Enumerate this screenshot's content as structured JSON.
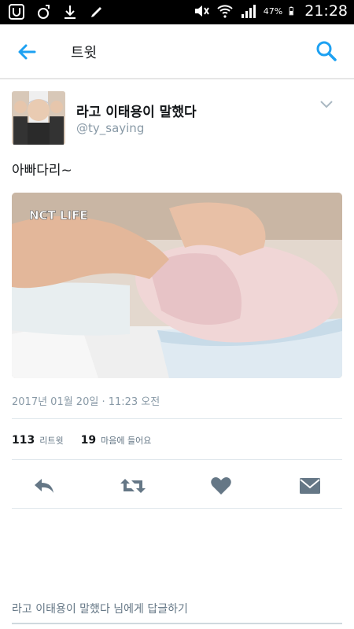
{
  "status_bar": {
    "battery": "47%",
    "time": "21:28"
  },
  "app_bar": {
    "title": "트윗"
  },
  "tweet": {
    "author_name": "라고 이태용이 말했다",
    "author_handle": "@ty_saying",
    "text": "아빠다리~",
    "media_watermark": "NCT LIFE",
    "date": "2017년 01월 20일 · 11:23 오전",
    "retweet_count": "113",
    "retweet_label": "리트윗",
    "like_count": "19",
    "like_label": "마음에 들어요"
  },
  "reply": {
    "placeholder": "라고 이태용이 말했다 님에게 답글하기"
  },
  "colors": {
    "accent": "#1da1f2",
    "icon_gray": "#657786",
    "divider": "#e1e8ed"
  }
}
